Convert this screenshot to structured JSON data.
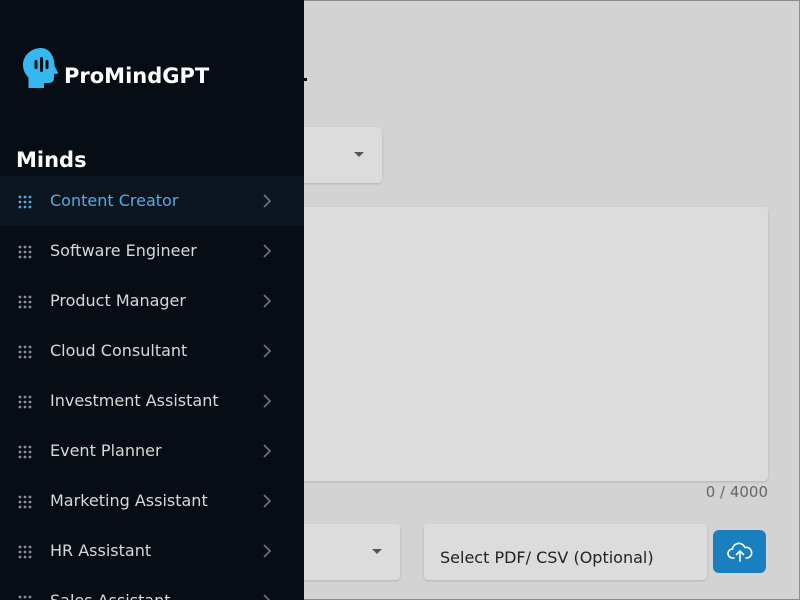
{
  "app": {
    "name": "ProMindGPT"
  },
  "sidebar": {
    "section_title": "Minds",
    "items": [
      {
        "label": "Content Creator",
        "active": true
      },
      {
        "label": "Software Engineer",
        "active": false
      },
      {
        "label": "Product Manager",
        "active": false
      },
      {
        "label": "Cloud Consultant",
        "active": false
      },
      {
        "label": "Investment Assistant",
        "active": false
      },
      {
        "label": "Event Planner",
        "active": false
      },
      {
        "label": "Marketing Assistant",
        "active": false
      },
      {
        "label": "HR Assistant",
        "active": false
      },
      {
        "label": "Sales Assistant",
        "active": false
      }
    ]
  },
  "main": {
    "prompt": {
      "char_count": "0 / 4000"
    },
    "file_field": {
      "label": "Select PDF/ CSV (Optional)"
    }
  },
  "colors": {
    "sidebar_bg": "#070d14",
    "accent": "#58a9e0",
    "upload_button": "#1a7fbf",
    "overlay": "#d3d3d3"
  },
  "icons": {
    "brand": "head-profile-icon",
    "nav_item": "grid-dots-icon",
    "nav_chevron": "chevron-right-icon",
    "upload": "cloud-upload-icon",
    "select_caret": "caret-down-icon"
  }
}
